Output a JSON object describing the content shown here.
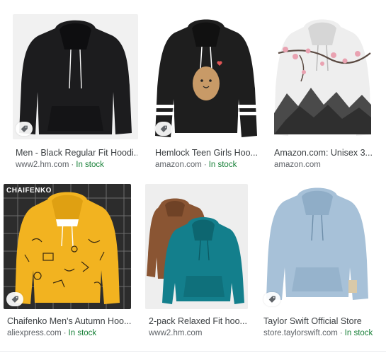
{
  "results": [
    {
      "title": "Men - Black Regular Fit Hoodi...",
      "source": "www2.hm.com",
      "stock": "In stock",
      "colors": {
        "bg": "#f1f1f1",
        "garment": "#1c1c1e"
      }
    },
    {
      "title": "Hemlock Teen Girls Hoo...",
      "source": "amazon.com",
      "stock": "In stock",
      "colors": {
        "bg": "#ffffff",
        "garment": "#1e1e1e",
        "stripe": "#ffffff",
        "potato": "#c89a67"
      }
    },
    {
      "title": "Amazon.com: Unisex 3...",
      "source": "amazon.com",
      "stock": "",
      "colors": {
        "bg": "#ffffff",
        "garment": "#eeeeee",
        "blossom": "#e9a2b1",
        "ink": "#4a4a4a"
      }
    },
    {
      "title": "Chaifenko Men's Autumn Hoo...",
      "source": "aliexpress.com",
      "stock": "In stock",
      "logo_text": "CHAIFENKO",
      "colors": {
        "bg": "#2c2c2c",
        "garment": "#f2b320"
      }
    },
    {
      "title": "2-pack Relaxed Fit hoo...",
      "source": "www2.hm.com",
      "stock": "",
      "colors": {
        "bg": "#eeeeee",
        "garment_back": "#8a5533",
        "garment_front": "#137f8c"
      }
    },
    {
      "title": "Taylor Swift Official Store",
      "source": "store.taylorswift.com",
      "stock": "In stock",
      "colors": {
        "bg": "#ffffff",
        "garment": "#a7c1d8"
      }
    }
  ]
}
